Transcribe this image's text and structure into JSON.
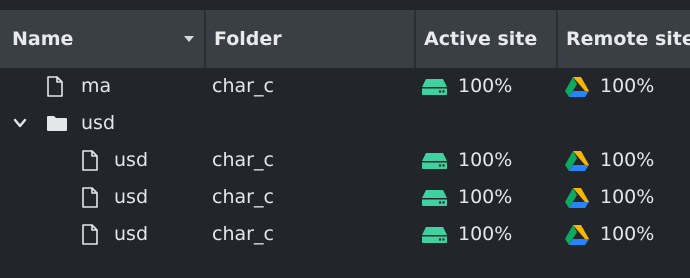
{
  "header": {
    "name": "Name",
    "folder": "Folder",
    "active_site": "Active site",
    "remote_site": "Remote site"
  },
  "rows": [
    {
      "type": "file",
      "name": "ma",
      "folder": "char_c",
      "active": "100%",
      "remote": "100%"
    },
    {
      "type": "folder",
      "name": "usd",
      "expanded": true
    },
    {
      "type": "file",
      "name": "usd",
      "folder": "char_c",
      "active": "100%",
      "remote": "100%"
    },
    {
      "type": "file",
      "name": "usd",
      "folder": "char_c",
      "active": "100%",
      "remote": "100%"
    },
    {
      "type": "file",
      "name": "usd",
      "folder": "char_c",
      "active": "100%",
      "remote": "100%"
    }
  ],
  "icons": {
    "file": "file-icon",
    "folder": "folder-icon",
    "expand": "chevron-down-icon",
    "active_site": "hard-drive-icon",
    "remote_site": "google-drive-icon"
  },
  "colors": {
    "background": "#22262b",
    "header": "#3a3f46",
    "drive_green": "#3fd1a0"
  }
}
